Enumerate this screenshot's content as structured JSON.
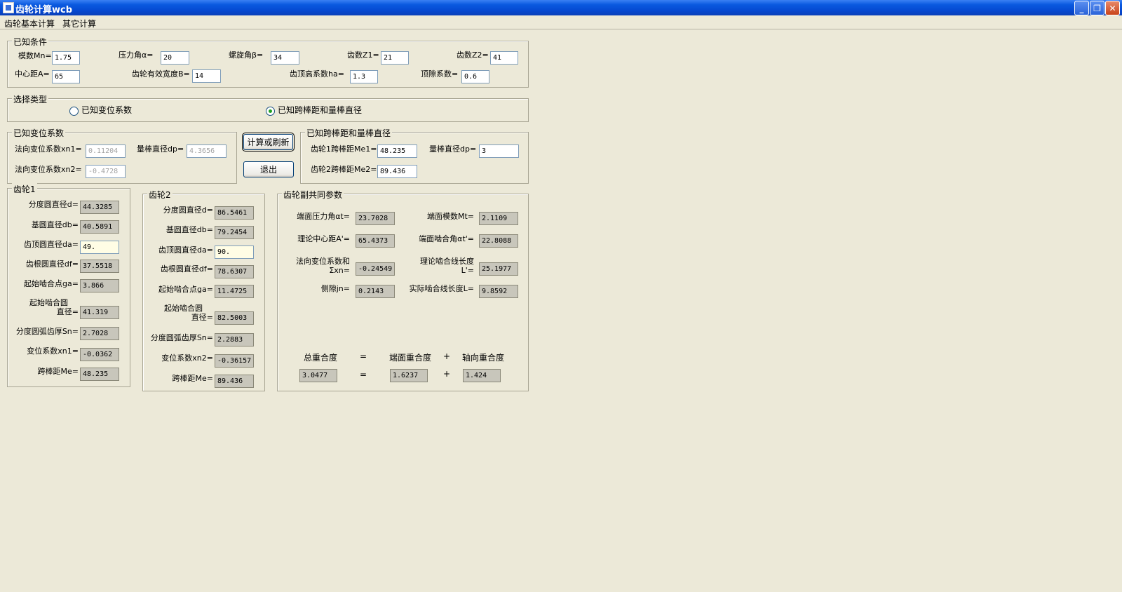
{
  "window": {
    "title": "齿轮计算wcb",
    "minimize_glyph": "_",
    "maximize_glyph": "❐",
    "close_glyph": "✕"
  },
  "menu": [
    "齿轮基本计算",
    "其它计算"
  ],
  "known": {
    "title": "已知条件",
    "mn_label": "模数Mn=",
    "mn": "1.75",
    "alpha_label": "压力角α=",
    "alpha": "20",
    "beta_label": "螺旋角β=",
    "beta": "34",
    "z1_label": "齿数Z1=",
    "z1": "21",
    "z2_label": "齿数Z2=",
    "z2": "41",
    "a_label": "中心距A=",
    "a": "65",
    "b_label": "齿轮有效宽度B=",
    "b": "14",
    "ha_label": "齿顶高系数ha=",
    "ha": "1.3",
    "c_label": "顶隙系数=",
    "c": "0.6"
  },
  "select": {
    "title": "选择类型",
    "opt1": "已知变位系数",
    "opt2": "已知跨棒距和量棒直径"
  },
  "shift": {
    "title": "已知变位系数",
    "xn1_label": "法向变位系数xn1=",
    "xn1": "0.11204",
    "dp_label": "量棒直径dp=",
    "dp": "4.3656",
    "xn2_label": "法向变位系数xn2=",
    "xn2": "-0.4728"
  },
  "buttons": {
    "calc": "计算或刷新",
    "exit": "退出"
  },
  "span": {
    "title": "已知跨棒距和量棒直径",
    "me1_label": "齿轮1跨棒距Me1=",
    "me1": "48.235",
    "dp_label": "量棒直径dp=",
    "dp": "3",
    "me2_label": "齿轮2跨棒距Me2=",
    "me2": "89.436"
  },
  "gear1": {
    "title": "齿轮1",
    "rows": [
      {
        "label": "分度圆直径d=",
        "value": "44.3285"
      },
      {
        "label": "基圆直径db=",
        "value": "40.5891"
      },
      {
        "label": "齿顶圆直径da=",
        "value": "49."
      },
      {
        "label": "齿根圆直径df=",
        "value": "37.5518"
      },
      {
        "label": "起始啮合点ga=",
        "value": "3.866"
      },
      {
        "label": "起始啮合圆",
        "label2": "直径=",
        "value": "41.319"
      },
      {
        "label": "分度圆弧齿厚Sn=",
        "value": "2.7028"
      },
      {
        "label": "变位系数xn1=",
        "value": "-0.0362"
      },
      {
        "label": "跨棒距Me=",
        "value": "48.235"
      }
    ]
  },
  "gear2": {
    "title": "齿轮2",
    "rows": [
      {
        "label": "分度圆直径d=",
        "value": "86.5461"
      },
      {
        "label": "基圆直径db=",
        "value": "79.2454"
      },
      {
        "label": "齿顶圆直径da=",
        "value": "90."
      },
      {
        "label": "齿根圆直径df=",
        "value": "78.6307"
      },
      {
        "label": "起始啮合点ga=",
        "value": "11.4725"
      },
      {
        "label": "起始啮合圆",
        "label2": "直径=",
        "value": "82.5003"
      },
      {
        "label": "分度圆弧齿厚Sn=",
        "value": "2.2883"
      },
      {
        "label": "变位系数xn2=",
        "value": "-0.36157"
      },
      {
        "label": "跨棒距Me=",
        "value": "89.436"
      }
    ]
  },
  "common": {
    "title": "齿轮副共同参数",
    "at_label": "端面压力角αt=",
    "at": "23.7028",
    "mt_label": "端面模数Mt=",
    "mt": "2.1109",
    "a_label": "理论中心距A'=",
    "a": "65.4373",
    "atp_label": "端面啮合角αt'=",
    "atp": "22.8088",
    "sx_label1": "法向变位系数和",
    "sx_label2": "Σxn=",
    "sx": "-0.24549",
    "lp_label1": "理论啮合线长度",
    "lp_label2": "L'=",
    "lp": "25.1977",
    "jn_label": "侧隙jn=",
    "jn": "0.2143",
    "l_label": "实际啮合线长度L=",
    "l": "9.8592",
    "total_label": "总重合度",
    "eq1": "=",
    "end_label": "端面重合度",
    "plus1": "+",
    "axial_label": "轴向重合度",
    "total": "3.0477",
    "eq2": "=",
    "end": "1.6237",
    "plus2": "+",
    "axial": "1.424"
  }
}
